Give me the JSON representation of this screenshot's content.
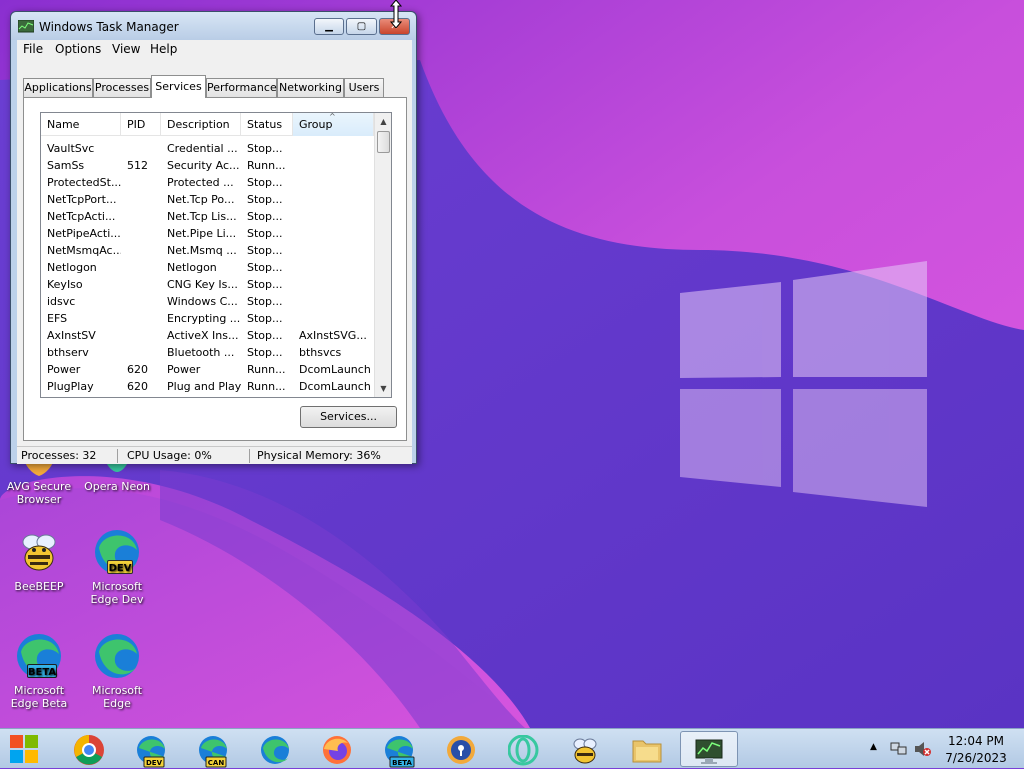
{
  "window": {
    "title": "Windows Task Manager",
    "menu": [
      "File",
      "Options",
      "View",
      "Help"
    ],
    "tabs": [
      "Applications",
      "Processes",
      "Services",
      "Performance",
      "Networking",
      "Users"
    ],
    "active_tab": "Services",
    "columns": [
      "Name",
      "PID",
      "Description",
      "Status",
      "Group"
    ],
    "sorted_column": "Group",
    "rows": [
      [
        "VaultSvc",
        "",
        "Credential ...",
        "Stop...",
        ""
      ],
      [
        "SamSs",
        "512",
        "Security Ac...",
        "Runn...",
        ""
      ],
      [
        "ProtectedSt...",
        "",
        "Protected ...",
        "Stop...",
        ""
      ],
      [
        "NetTcpPort...",
        "",
        "Net.Tcp Po...",
        "Stop...",
        ""
      ],
      [
        "NetTcpActi...",
        "",
        "Net.Tcp Lis...",
        "Stop...",
        ""
      ],
      [
        "NetPipeActi...",
        "",
        "Net.Pipe Li...",
        "Stop...",
        ""
      ],
      [
        "NetMsmqAc...",
        "",
        "Net.Msmq ...",
        "Stop...",
        ""
      ],
      [
        "Netlogon",
        "",
        "Netlogon",
        "Stop...",
        ""
      ],
      [
        "KeyIso",
        "",
        "CNG Key Is...",
        "Stop...",
        ""
      ],
      [
        "idsvc",
        "",
        "Windows C...",
        "Stop...",
        ""
      ],
      [
        "EFS",
        "",
        "Encrypting ...",
        "Stop...",
        ""
      ],
      [
        "AxInstSV",
        "",
        "ActiveX Ins...",
        "Stop...",
        "AxInstSVG..."
      ],
      [
        "bthserv",
        "",
        "Bluetooth ...",
        "Stop...",
        "bthsvcs"
      ],
      [
        "Power",
        "620",
        "Power",
        "Runn...",
        "DcomLaunch"
      ],
      [
        "PlugPlay",
        "620",
        "Plug and Play",
        "Runn...",
        "DcomLaunch"
      ]
    ],
    "services_button": "Services...",
    "status": {
      "processes": "Processes: 32",
      "cpu": "CPU Usage: 0%",
      "memory": "Physical Memory: 36%"
    }
  },
  "desktop_icons": {
    "avg": "AVG Secure Browser",
    "opera_neon": "Opera Neon",
    "beebeep": "BeeBEEP",
    "edge_dev": "Microsoft Edge Dev",
    "edge_beta": "Microsoft Edge Beta",
    "edge": "Microsoft Edge",
    "badge_dev": "DEV",
    "badge_beta": "BETA"
  },
  "taskbar": {
    "apps": [
      "start-button",
      "chrome",
      "edge-dev",
      "edge-canary",
      "edge",
      "firefox",
      "edge-beta",
      "avg-secure-browser",
      "opera-neon",
      "beebeep",
      "file-explorer",
      "task-manager"
    ],
    "badge_dev": "DEV",
    "badge_can": "CAN",
    "badge_beta": "BETA",
    "time": "12:04 PM",
    "date": "7/26/2023"
  },
  "colors": {
    "wallpaper_pink": "#d14bd6",
    "wallpaper_purple": "#5a36c8",
    "edge_blue": "#1a7fd8",
    "edge_green": "#3ec46d"
  }
}
